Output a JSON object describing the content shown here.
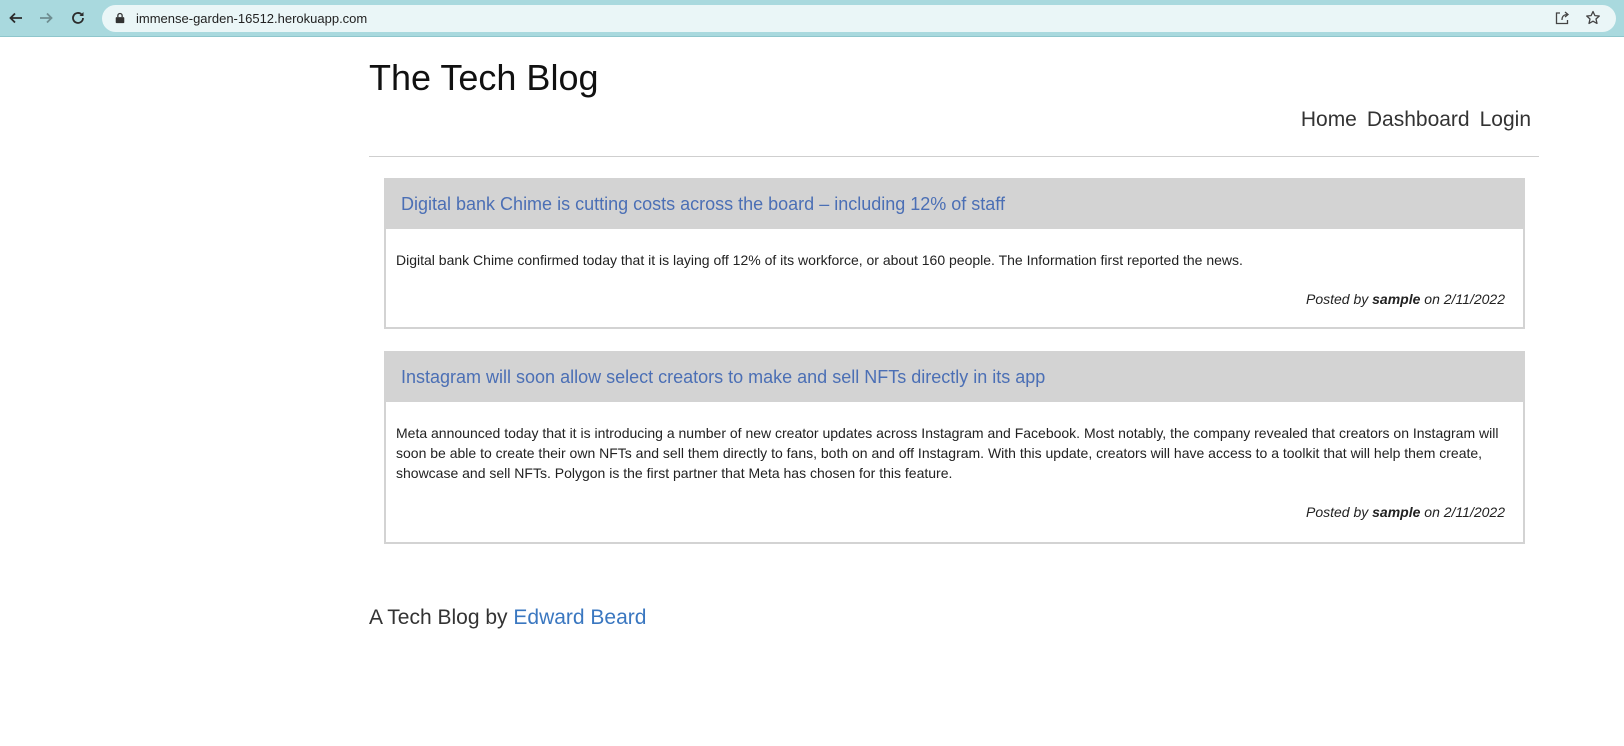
{
  "browser": {
    "url": "immense-garden-16512.herokuapp.com"
  },
  "site": {
    "title": "The Tech Blog",
    "nav": [
      "Home",
      "Dashboard",
      "Login"
    ]
  },
  "posts": [
    {
      "title": "Digital bank Chime is cutting costs across the board – including 12% of staff",
      "body": "Digital bank Chime confirmed today that it is laying off 12% of its workforce, or about 160 people. The Information first reported the news.",
      "posted_by_prefix": "Posted by",
      "author": "sample",
      "on_word": "on",
      "date": "2/11/2022"
    },
    {
      "title": "Instagram will soon allow select creators to make and sell NFTs directly in its app",
      "body": "Meta announced today that it is introducing a number of new creator updates across Instagram and Facebook. Most notably, the company revealed that creators on Instagram will soon be able to create their own NFTs and sell them directly to fans, both on and off Instagram. With this update, creators will have access to a toolkit that will help them create, showcase and sell NFTs. Polygon is the first partner that Meta has chosen for this feature.",
      "posted_by_prefix": "Posted by",
      "author": "sample",
      "on_word": "on",
      "date": "2/11/2022"
    }
  ],
  "footer": {
    "text": "A Tech Blog by",
    "author_link": "Edward Beard"
  },
  "colors": {
    "chrome": "#a9d9de",
    "link": "#4b6fb5",
    "post_header": "#d3d3d3"
  }
}
